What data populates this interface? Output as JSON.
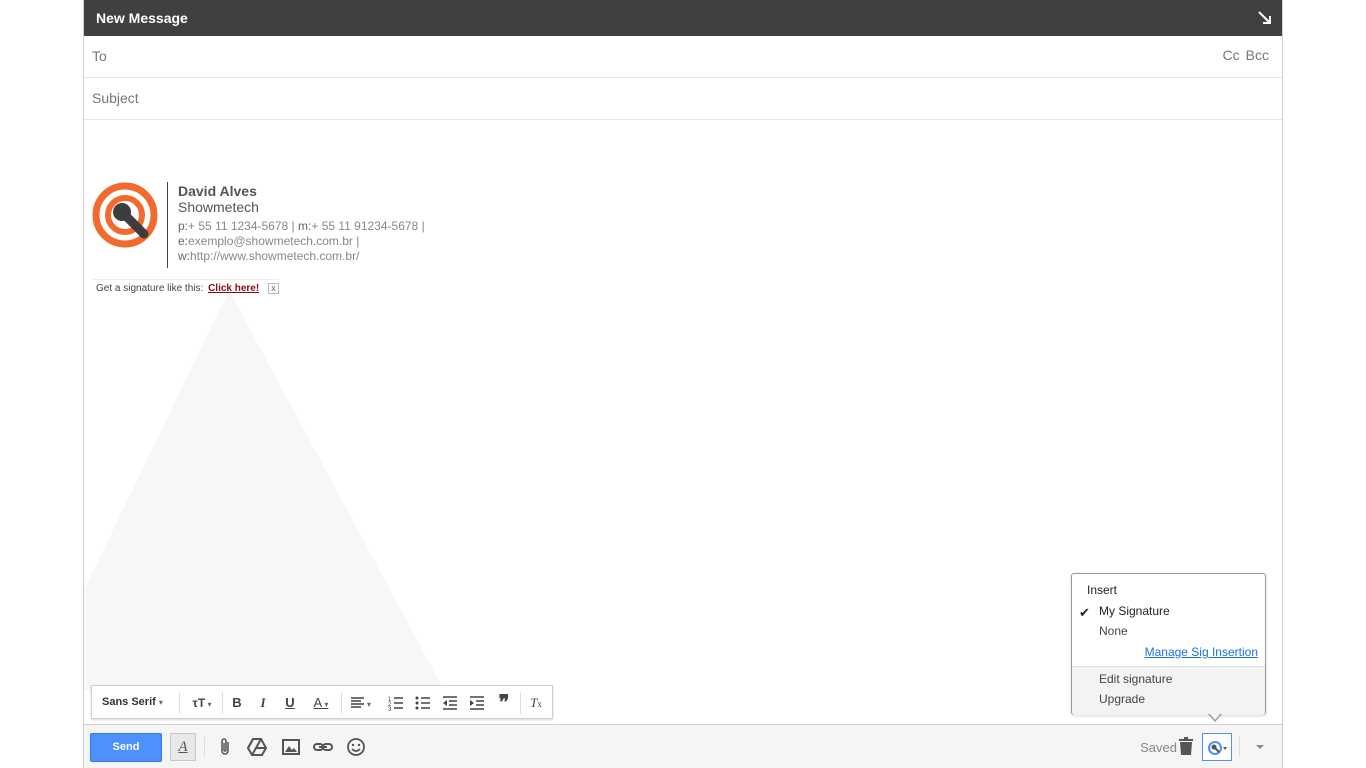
{
  "compose": {
    "title": "New Message",
    "to_label": "To",
    "cc_label": "Cc",
    "bcc_label": "Bcc",
    "subject_placeholder": "Subject"
  },
  "signature": {
    "name": "David Alves",
    "company": "Showmetech",
    "phone_line_prefix_p": "p:",
    "phone_value": "+ 55 11 1234-5678",
    "mobile_prefix": "m:",
    "mobile_value": "+ 55 11 91234-5678",
    "email_prefix": "e:",
    "email_value": "exemplo@showmetech.com.br",
    "web_prefix": "w:",
    "web_value": "http://www.showmetech.com.br/",
    "separator": " | ",
    "logo_color": "#f26a2e",
    "logo_dark": "#3d3d3d"
  },
  "promo": {
    "text": "Get a signature like this:",
    "link": "Click here!",
    "close": "x"
  },
  "sig_menu": {
    "insert": "Insert",
    "check": "✔",
    "my_signature": "My Signature",
    "none": "None",
    "manage": "Manage Sig Insertion",
    "edit": "Edit signature",
    "upgrade": "Upgrade"
  },
  "format_bar": {
    "font": "Sans Serif",
    "icons": [
      "text-size-icon",
      "bold-icon",
      "italic-icon",
      "underline-icon",
      "text-color-icon",
      "align-icon",
      "numbered-list-icon",
      "bulleted-list-icon",
      "indent-less-icon",
      "indent-more-icon",
      "quote-icon",
      "remove-formatting-icon"
    ]
  },
  "bottom_bar": {
    "send": "Send",
    "saved": "Saved",
    "icons": [
      "formatting-icon",
      "attach-icon",
      "drive-icon",
      "photo-icon",
      "link-icon",
      "emoji-icon",
      "trash-icon",
      "signature-icon",
      "more-options-icon"
    ]
  },
  "colors": {
    "titlebar": "#404040",
    "send_button": "#4d90fe",
    "link": "#1a73e8",
    "promo_link": "#8b0a19"
  }
}
